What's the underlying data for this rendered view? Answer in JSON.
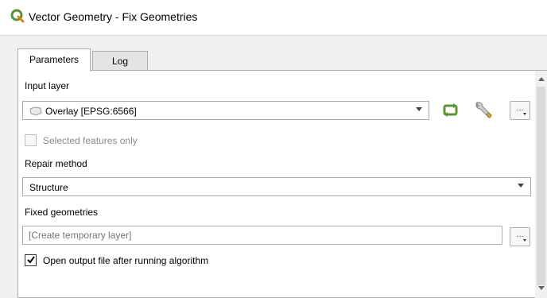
{
  "window": {
    "title": "Vector Geometry - Fix Geometries",
    "icon": "qgis-logo-icon",
    "brand_color": "#589632"
  },
  "tabs": [
    {
      "label": "Parameters",
      "active": true
    },
    {
      "label": "Log",
      "active": false
    }
  ],
  "form": {
    "input_layer_label": "Input layer",
    "input_layer_value": "Overlay [EPSG:6566]",
    "selected_features_label": "Selected features only",
    "selected_features_checked": false,
    "repair_method_label": "Repair method",
    "repair_method_value": "Structure",
    "fixed_geometries_label": "Fixed geometries",
    "fixed_geometries_placeholder": "[Create temporary layer]",
    "open_output_label": "Open output file after running algorithm",
    "open_output_checked": true,
    "dots_label": "…"
  },
  "icons": {
    "layer": "polygon-layer-icon",
    "iterate": "iterate-icon",
    "settings": "wrench-icon"
  }
}
